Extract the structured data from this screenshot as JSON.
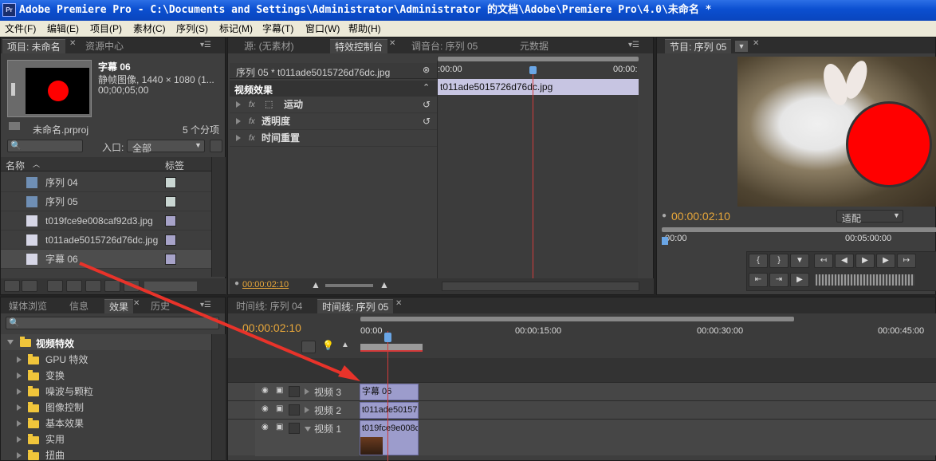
{
  "window": {
    "title": "Adobe Premiere Pro - C:\\Documents and Settings\\Administrator\\Administrator 的文档\\Adobe\\Premiere Pro\\4.0\\未命名 *",
    "app_icon": "Pr"
  },
  "menu": [
    "文件(F)",
    "编辑(E)",
    "项目(P)",
    "素材(C)",
    "序列(S)",
    "标记(M)",
    "字幕(T)",
    "窗口(W)",
    "帮助(H)"
  ],
  "project": {
    "tabs": [
      "项目: 未命名",
      "资源中心"
    ],
    "clip_name": "字幕 06",
    "clip_type": "静帧图像, 1440 × 1080 (1...",
    "clip_duration": "00;00;05;00",
    "project_file": "未命名.prproj",
    "item_count": "5 个分项",
    "in_label": "入口:",
    "in_value": "全部",
    "col_name": "名称",
    "col_label": "标签",
    "items": [
      {
        "name": "序列 04",
        "icon": "sequence-icon",
        "color": "#c9d6d2"
      },
      {
        "name": "序列 05",
        "icon": "sequence-icon",
        "color": "#c9d6d2"
      },
      {
        "name": "t019fce9e008caf92d3.jpg",
        "icon": "image-file-icon",
        "color": "#a7a3c9"
      },
      {
        "name": "t011ade5015726d76dc.jpg",
        "icon": "image-file-icon",
        "color": "#a7a3c9"
      },
      {
        "name": "字幕 06",
        "icon": "title-file-icon",
        "color": "#a7a3c9"
      }
    ]
  },
  "effect_controls": {
    "tabs": [
      "源: (无素材)",
      "特效控制台",
      "调音台: 序列 05",
      "元数据"
    ],
    "source": "序列 05 * t011ade5015726d76dc.jpg",
    "video_effects": "视频效果",
    "effects": [
      "运动",
      "透明度",
      "时间重置"
    ],
    "ruler_start": ":00:00",
    "ruler_end": "00:00:",
    "clip_label": "t011ade5015726d76dc.jpg",
    "timecode": "00:00:02:10"
  },
  "program": {
    "tab": "节目: 序列 05",
    "timecode": "00:00:02:10",
    "fit": "适配",
    "ruler_start": "00:00",
    "ruler_mid": "00:05:00:00"
  },
  "effects_panel": {
    "tabs": [
      "媒体浏览",
      "信息",
      "效果",
      "历史"
    ],
    "root": "视频特效",
    "folders": [
      "GPU 特效",
      "变换",
      "噪波与颗粒",
      "图像控制",
      "基本效果",
      "实用",
      "扭曲"
    ]
  },
  "timeline": {
    "tabs": [
      "时间线: 序列 04",
      "时间线: 序列 05"
    ],
    "timecode": "00:00:02:10",
    "ruler": [
      "00:00",
      "00:00:15:00",
      "00:00:30:00",
      "00:00:45:00"
    ],
    "tracks": [
      "视频 3",
      "视频 2",
      "视频 1"
    ],
    "clips": [
      "字幕 06",
      "t011ade50157",
      "t019fce9e008c"
    ]
  },
  "colors": {
    "accent": "#e8a73a",
    "annotation_arrow": "#e8332a",
    "clip": "#9c9ccc",
    "red_dot": "#ff0000"
  }
}
